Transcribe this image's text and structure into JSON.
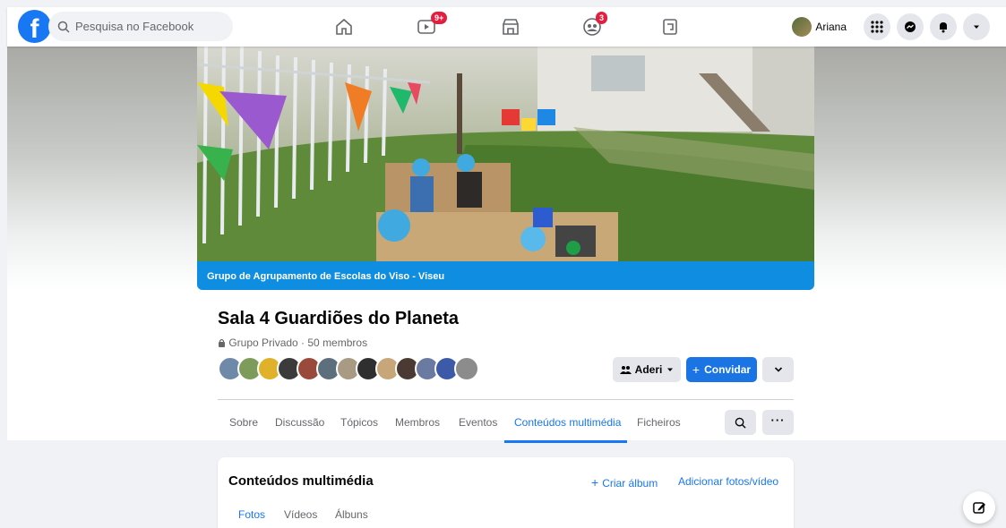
{
  "colors": {
    "brand": "#1877f2",
    "badge": "#e41e3f",
    "banner": "#0f8de0"
  },
  "header": {
    "search_placeholder": "Pesquisa no Facebook",
    "nav": [
      {
        "name": "home",
        "icon": "home-icon"
      },
      {
        "name": "watch",
        "icon": "video-icon",
        "badge": "9+"
      },
      {
        "name": "marketplace",
        "icon": "marketplace-icon"
      },
      {
        "name": "groups",
        "icon": "groups-icon",
        "badge": "3"
      },
      {
        "name": "gaming",
        "icon": "gaming-icon"
      }
    ],
    "profile_name": "Ariana",
    "right_icons": [
      "menu-grid-icon",
      "messenger-icon",
      "notifications-icon",
      "account-chevron-icon"
    ]
  },
  "cover": {
    "banner_text": "Grupo de Agrupamento de Escolas do Viso - Viseu"
  },
  "group": {
    "title": "Sala 4 Guardiões do Planeta",
    "meta": "Grupo Privado · 50 membros",
    "aderi_label": "Aderi",
    "convidar_label": "Convidar"
  },
  "tabs": {
    "items": [
      "Sobre",
      "Discussão",
      "Tópicos",
      "Membros",
      "Eventos",
      "Conteúdos multimédia",
      "Ficheiros"
    ],
    "active": "Conteúdos multimédia"
  },
  "media": {
    "title": "Conteúdos multimédia",
    "create_album": "Criar álbum",
    "add_media": "Adicionar fotos/vídeo",
    "subtabs": [
      "Fotos",
      "Vídeos",
      "Álbuns"
    ],
    "active_subtab": "Fotos"
  }
}
